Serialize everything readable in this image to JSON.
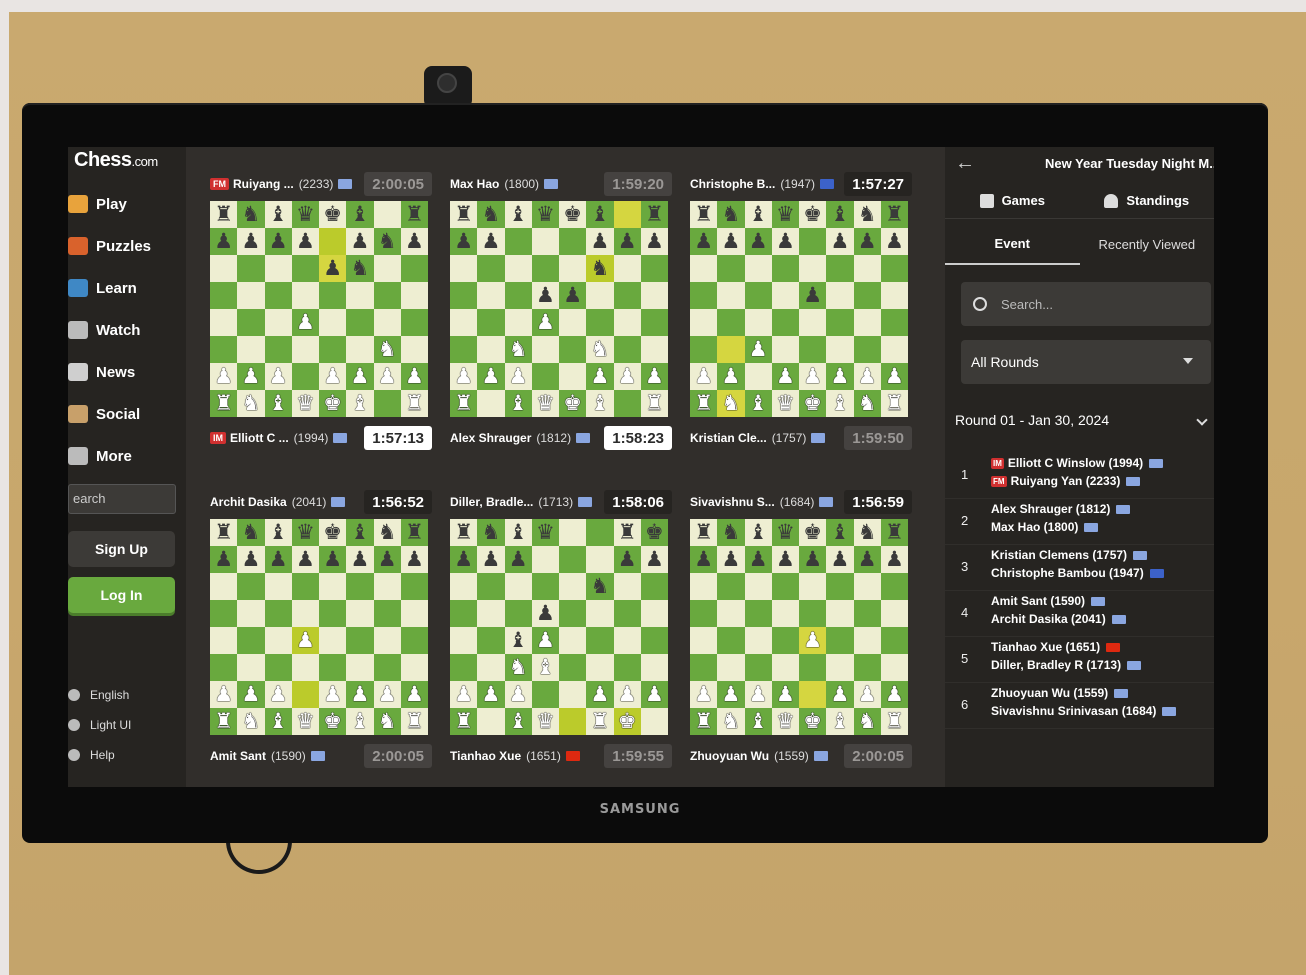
{
  "colors": {
    "accent": "#69a93e",
    "usa_flag": "#8aa6e0",
    "fr_flag": "#3c62c9",
    "cn_flag": "#de2910"
  },
  "device": {
    "brand": "SAMSUNG"
  },
  "sidebar": {
    "logo_main": "Chess",
    "logo_sub": ".com",
    "items": [
      {
        "label": "Play",
        "icon": "pawn-icon"
      },
      {
        "label": "Puzzles",
        "icon": "puzzle-icon"
      },
      {
        "label": "Learn",
        "icon": "book-icon"
      },
      {
        "label": "Watch",
        "icon": "watch-icon"
      },
      {
        "label": "News",
        "icon": "news-icon"
      },
      {
        "label": "Social",
        "icon": "social-icon"
      },
      {
        "label": "More",
        "icon": "more-icon"
      }
    ],
    "search_placeholder": "earch",
    "signup_label": "Sign Up",
    "login_label": "Log In",
    "footer": [
      {
        "label": "English",
        "icon": "globe-icon"
      },
      {
        "label": "Light UI",
        "icon": "sun-icon"
      },
      {
        "label": "Help",
        "icon": "help-icon"
      }
    ]
  },
  "games": [
    {
      "top": {
        "title": "FM",
        "name": "Ruiyang ...",
        "rating": "(2233)",
        "flag": "usa",
        "clock": "2:00:05",
        "clock_state": "idle"
      },
      "bottom": {
        "title": "IM",
        "name": "Elliott C ...",
        "rating": "(1994)",
        "flag": "usa",
        "clock": "1:57:13",
        "clock_state": "white"
      },
      "board": [
        "rnbqkb.r",
        "pppp.pnp",
        "....pn..",
        "........",
        "...P....",
        "......N.",
        "PPP.PPPP",
        "RNBQKB.R"
      ],
      "highlights": [
        "e7",
        "e6"
      ]
    },
    {
      "top": {
        "title": "",
        "name": "Max Hao",
        "rating": "(1800)",
        "flag": "usa",
        "clock": "1:59:20",
        "clock_state": "idle"
      },
      "bottom": {
        "title": "",
        "name": "Alex Shrauger",
        "rating": "(1812)",
        "flag": "usa",
        "clock": "1:58:23",
        "clock_state": "white"
      },
      "board": [
        "rnbqkb.r",
        "pp...ppp",
        ".....n..",
        "...pp...",
        "...P....",
        "..N..N..",
        "PPP..PPP",
        "R.BQKB.R"
      ],
      "highlights": [
        "g8",
        "f6"
      ]
    },
    {
      "top": {
        "title": "",
        "name": "Christophe B...",
        "rating": "(1947)",
        "flag": "fr",
        "clock": "1:57:27",
        "clock_state": "black"
      },
      "bottom": {
        "title": "",
        "name": "Kristian Cle...",
        "rating": "(1757)",
        "flag": "usa",
        "clock": "1:59:50",
        "clock_state": "idle"
      },
      "board": [
        "rnbqkbnr",
        "pppp.ppp",
        "........",
        "....p...",
        "........",
        "..P.....",
        "PP.PPPPP",
        "RNBQKBNR"
      ],
      "highlights": [
        "b1",
        "b3"
      ]
    },
    {
      "top": {
        "title": "",
        "name": "Archit Dasika",
        "rating": "(2041)",
        "flag": "usa",
        "clock": "1:56:52",
        "clock_state": "black"
      },
      "bottom": {
        "title": "",
        "name": "Amit Sant",
        "rating": "(1590)",
        "flag": "usa",
        "clock": "2:00:05",
        "clock_state": "idle"
      },
      "board": [
        "rnbqkbnr",
        "pppppppp",
        "........",
        "........",
        "...P....",
        "........",
        "PPP.PPPP",
        "RNBQKBNR"
      ],
      "highlights": [
        "d2",
        "d4"
      ]
    },
    {
      "top": {
        "title": "",
        "name": "Diller, Bradle...",
        "rating": "(1713)",
        "flag": "usa",
        "clock": "1:58:06",
        "clock_state": "black"
      },
      "bottom": {
        "title": "",
        "name": "Tianhao Xue",
        "rating": "(1651)",
        "flag": "cn",
        "clock": "1:59:55",
        "clock_state": "idle"
      },
      "board": [
        "rnbq..rk",
        "ppp...pp",
        ".....n..",
        "...p....",
        "..bP....",
        "..NB....",
        "PPP..PPP",
        "R.BQ.RK."
      ],
      "highlights": [
        "e1",
        "g1"
      ]
    },
    {
      "top": {
        "title": "",
        "name": "Sivavishnu S...",
        "rating": "(1684)",
        "flag": "usa",
        "clock": "1:56:59",
        "clock_state": "black"
      },
      "bottom": {
        "title": "",
        "name": "Zhuoyuan Wu",
        "rating": "(1559)",
        "flag": "usa",
        "clock": "2:00:05",
        "clock_state": "idle"
      },
      "board": [
        "rnbqkbnr",
        "pppppppp",
        "........",
        "........",
        "....P...",
        "........",
        "PPPP.PPP",
        "RNBQKBNR"
      ],
      "highlights": [
        "e2",
        "e4"
      ]
    }
  ],
  "panel": {
    "title": "New Year Tuesday Night M...",
    "tabs": [
      {
        "label": "Games",
        "icon": "board-icon"
      },
      {
        "label": "Standings",
        "icon": "person-icon"
      }
    ],
    "subtabs": [
      "Event",
      "Recently Viewed"
    ],
    "search_placeholder": "Search...",
    "rounds_select": "All Rounds",
    "round_header": "Round 01 - Jan 30, 2024",
    "pairings": [
      {
        "num": "1",
        "p1": {
          "title": "IM",
          "name": "Elliott C Winslow (1994)",
          "flag": "usa"
        },
        "p2": {
          "title": "FM",
          "name": "Ruiyang Yan (2233)",
          "flag": "usa"
        }
      },
      {
        "num": "2",
        "p1": {
          "title": "",
          "name": "Alex Shrauger (1812)",
          "flag": "usa"
        },
        "p2": {
          "title": "",
          "name": "Max Hao (1800)",
          "flag": "usa"
        }
      },
      {
        "num": "3",
        "p1": {
          "title": "",
          "name": "Kristian Clemens (1757)",
          "flag": "usa"
        },
        "p2": {
          "title": "",
          "name": "Christophe Bambou (1947)",
          "flag": "fr"
        }
      },
      {
        "num": "4",
        "p1": {
          "title": "",
          "name": "Amit Sant (1590)",
          "flag": "usa"
        },
        "p2": {
          "title": "",
          "name": "Archit Dasika (2041)",
          "flag": "usa"
        }
      },
      {
        "num": "5",
        "p1": {
          "title": "",
          "name": "Tianhao Xue (1651)",
          "flag": "cn"
        },
        "p2": {
          "title": "",
          "name": "Diller, Bradley R (1713)",
          "flag": "usa"
        }
      },
      {
        "num": "6",
        "p1": {
          "title": "",
          "name": "Zhuoyuan Wu (1559)",
          "flag": "usa"
        },
        "p2": {
          "title": "",
          "name": "Sivavishnu Srinivasan (1684)",
          "flag": "usa"
        }
      }
    ]
  }
}
